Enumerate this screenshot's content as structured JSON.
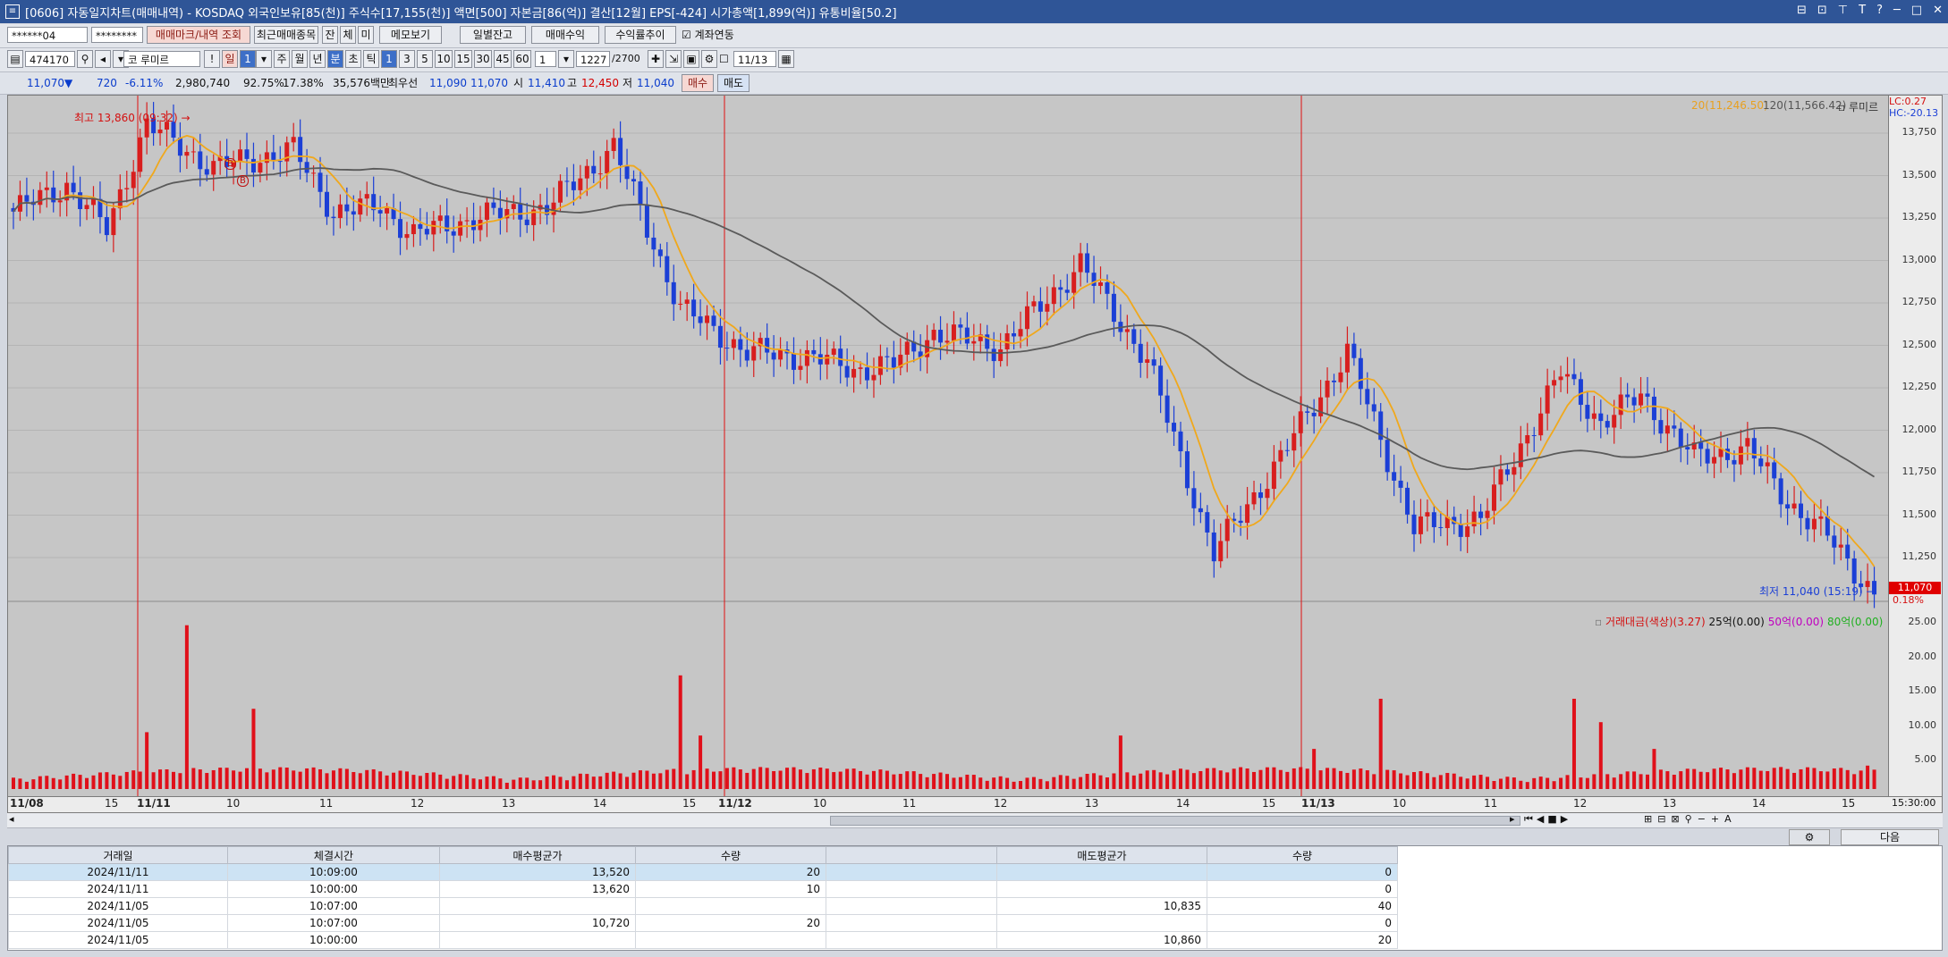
{
  "titlebar": {
    "title": "[0606] 자동일지차트(매매내역) - KOSDAQ 외국인보유[85(천)] 주식수[17,155(천)] 액면[500] 자본금[86(억)] 결산[12월] EPS[-424] 시가총액[1,899(억)] 유통비율[50.2]",
    "buttons": [
      "⊟",
      "⊡",
      "⊤",
      "T",
      "?",
      "─",
      "□",
      "✕"
    ]
  },
  "toolbar1": {
    "account": "******04",
    "password": "********",
    "btn_trade_marks": "매매마크/내역 조회",
    "btn_recent": "최근매매종목",
    "btn_jan": "잔",
    "btn_che": "체",
    "btn_mi": "미",
    "btn_memo": "메모보기",
    "btn_daily_balance": "일별잔고",
    "btn_trade_profit": "매매수익",
    "btn_return_trend": "수익률추이",
    "chk_account_link": "계좌연동"
  },
  "toolbar2": {
    "code": "474170",
    "name_prefix": "코",
    "stock_name": "루미르",
    "day_label": "일",
    "day_value": "1",
    "period_buttons": [
      "주",
      "월",
      "년",
      "분",
      "초",
      "틱"
    ],
    "interval_buttons": [
      "1",
      "3",
      "5",
      "10",
      "15",
      "30",
      "45",
      "60"
    ],
    "interval_select": "1",
    "count": "1227",
    "count_total": "/2700",
    "date": "11/13"
  },
  "quote": {
    "price": "11,070",
    "arrow": "▼",
    "change": "720",
    "change_pct": "-6.11%",
    "volume": "2,980,740",
    "pct1": "92.75%",
    "pct2": "17.38%",
    "amount": "35,576백만",
    "best_label": "최우선",
    "best_ask": "11,090",
    "best_bid": "11,070",
    "open_label": "시",
    "open": "11,410",
    "high_label": "고",
    "high": "12,450",
    "low_label": "저",
    "low": "11,040",
    "buy_btn": "매수",
    "sell_btn": "매도"
  },
  "legend_top": {
    "ma20": "20(11,246.50)",
    "ma120": "120(11,566.42)",
    "name": "루미르",
    "lc": "LC:0.27",
    "hc": "HC:-20.13"
  },
  "legend_volume": {
    "label": "거래대금(색상)(3.27)",
    "ma25": "25억(0.00)",
    "ma50": "50억(0.00)",
    "ma80": "80억(0.00)"
  },
  "annotations": {
    "high": "최고 13,860 (09:32)",
    "low": "최저 11,040 (15:19)",
    "price_tag": "11,070",
    "pct_tag": "0.18%",
    "time_tag": "15:30:00",
    "mark_b": "B"
  },
  "colors": {
    "candle_up": "#d81e1e",
    "candle_down": "#1b3fd6",
    "ma20": "#f0a81c",
    "ma120": "#5a5a5a",
    "volume": "#e0101a",
    "divider": "#e01010"
  },
  "chart_data": {
    "type": "candlestick",
    "y_price_ticks": [
      "13,750",
      "13,500",
      "13,250",
      "13,000",
      "12,750",
      "12,500",
      "12,250",
      "12,000",
      "11,750",
      "11,500",
      "11,250"
    ],
    "y_price_range": [
      11050,
      13860
    ],
    "y_volume_ticks": [
      "25.00",
      "20.00",
      "15.00",
      "10.00",
      "5.00"
    ],
    "y_volume_range": [
      0,
      27
    ],
    "x_ticks": [
      "11/08",
      "15",
      "11/11",
      "10",
      "11",
      "12",
      "13",
      "14",
      "15",
      "11/12",
      "10",
      "11",
      "12",
      "13",
      "14",
      "15",
      "11/13",
      "10",
      "11",
      "12",
      "13",
      "14",
      "15"
    ],
    "price_series": {
      "name": "루미르",
      "anchor_index": [
        0,
        8,
        14,
        20,
        30,
        42,
        48,
        55,
        60,
        70,
        80,
        90,
        100,
        110,
        120,
        126,
        132,
        138,
        148,
        160,
        170,
        180,
        190,
        200,
        210,
        220,
        232,
        238,
        244,
        252,
        260,
        266,
        272,
        279
      ],
      "anchor_value": [
        13250,
        13400,
        13150,
        13750,
        13500,
        13600,
        13250,
        13280,
        13120,
        13220,
        13270,
        13620,
        12700,
        12450,
        12420,
        12350,
        12380,
        12560,
        12480,
        12950,
        12400,
        11300,
        11850,
        12450,
        11450,
        11500,
        12330,
        12050,
        12200,
        11850,
        11900,
        11600,
        11400,
        11070
      ]
    },
    "volume_series": {
      "name": "거래대금",
      "peaks": [
        {
          "index": 20,
          "value": 8.5
        },
        {
          "index": 26,
          "value": 24.5
        },
        {
          "index": 36,
          "value": 12
        },
        {
          "index": 100,
          "value": 17
        },
        {
          "index": 103,
          "value": 8
        },
        {
          "index": 166,
          "value": 8
        },
        {
          "index": 195,
          "value": 6
        },
        {
          "index": 205,
          "value": 13.5
        },
        {
          "index": 234,
          "value": 13.5
        },
        {
          "index": 238,
          "value": 10
        },
        {
          "index": 246,
          "value": 6
        },
        {
          "index": 278,
          "value": 3.5
        }
      ]
    },
    "day_dividers": [
      "11/11",
      "11/12",
      "11/13"
    ]
  },
  "trade_table": {
    "columns": [
      "거래일",
      "체결시간",
      "매수평균가",
      "수량",
      "",
      "매도평균가",
      "수량"
    ],
    "rows": [
      [
        "2024/11/11",
        "10:09:00",
        "13,520",
        "20",
        "",
        "",
        "0"
      ],
      [
        "2024/11/11",
        "10:00:00",
        "13,620",
        "10",
        "",
        "",
        "0"
      ],
      [
        "2024/11/05",
        "10:07:00",
        "",
        "",
        "",
        "10,835",
        "40"
      ],
      [
        "2024/11/05",
        "10:07:00",
        "10,720",
        "20",
        "",
        "",
        "0"
      ],
      [
        "2024/11/05",
        "10:00:00",
        "",
        "",
        "",
        "10,860",
        "20"
      ]
    ]
  },
  "bottom_buttons": {
    "settings": "⚙",
    "next": "다음"
  }
}
